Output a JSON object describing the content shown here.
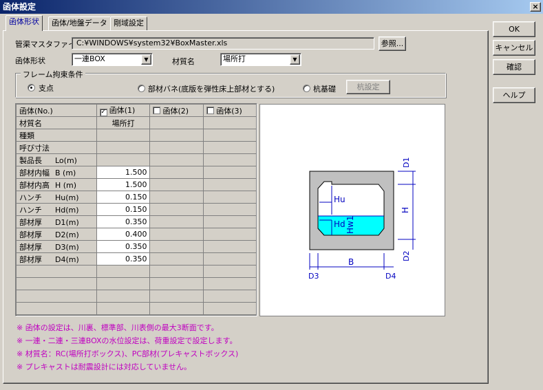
{
  "window": {
    "title": "函体設定",
    "close_glyph": "×"
  },
  "tabs": [
    "函体形状",
    "函体/地盤データ",
    "剛域設定"
  ],
  "buttons": {
    "ok": "OK",
    "cancel": "キャンセル",
    "confirm": "確認",
    "help": "ヘルプ",
    "browse": "参照...",
    "pile_settings": "杭設定"
  },
  "form": {
    "master_file_label": "管渠マスタファイル",
    "master_file_value": "C:¥WINDOWS¥system32¥BoxMaster.xls",
    "shape_label": "函体形状",
    "shape_value": "一連BOX",
    "material_label": "材質名",
    "material_value": "場所打"
  },
  "frame_constraint": {
    "title": "フレーム拘束条件",
    "options": [
      "支点",
      "部材バネ(底版を弾性床上部材とする)",
      "杭基礎"
    ],
    "selected": "支点"
  },
  "grid": {
    "header": [
      "函体(No.)",
      "函体(1)",
      "函体(2)",
      "函体(3)"
    ],
    "checked": [
      true,
      false,
      false
    ],
    "rows": [
      {
        "label": "材質名",
        "unit": "",
        "v1": "場所打"
      },
      {
        "label": "種類",
        "unit": "",
        "v1": ""
      },
      {
        "label": "呼び寸法",
        "unit": "",
        "v1": ""
      },
      {
        "label": "製品長",
        "unit": "Lo(m)",
        "v1": ""
      },
      {
        "label": "部材内幅",
        "unit": "B (m)",
        "v1": "1.500"
      },
      {
        "label": "部材内高",
        "unit": "H (m)",
        "v1": "1.500"
      },
      {
        "label": "ハンチ",
        "unit": "Hu(m)",
        "v1": "0.150"
      },
      {
        "label": "ハンチ",
        "unit": "Hd(m)",
        "v1": "0.150"
      },
      {
        "label": "部材厚",
        "unit": "D1(m)",
        "v1": "0.350"
      },
      {
        "label": "部材厚",
        "unit": "D2(m)",
        "v1": "0.400"
      },
      {
        "label": "部材厚",
        "unit": "D3(m)",
        "v1": "0.350"
      },
      {
        "label": "部材厚",
        "unit": "D4(m)",
        "v1": "0.350"
      }
    ],
    "empty_rows": 4
  },
  "diagram": {
    "labels": {
      "d1": "D1",
      "d2": "D2",
      "d3": "D3",
      "d4": "D4",
      "b": "B",
      "h": "H",
      "hu": "Hu",
      "hd": "Hd",
      "hw1": "Hw1"
    }
  },
  "notes": [
    "※ 函体の設定は、川裏、標準部、川表側の最大3断面です。",
    "※ 一連・二連・三連BOXの水位設定は、荷重設定で設定します。",
    "※ 材質名：RC(場所打ボックス)、PC部材(プレキャストボックス)",
    "※ プレキャストは耐震設計には対応していません。"
  ],
  "colors": {
    "title_start": "#0a246a",
    "title_end": "#a6caf0",
    "note": "#c000c0",
    "water": "#00ffff",
    "dim": "#0000c0",
    "tab_active": "#0000a0"
  }
}
